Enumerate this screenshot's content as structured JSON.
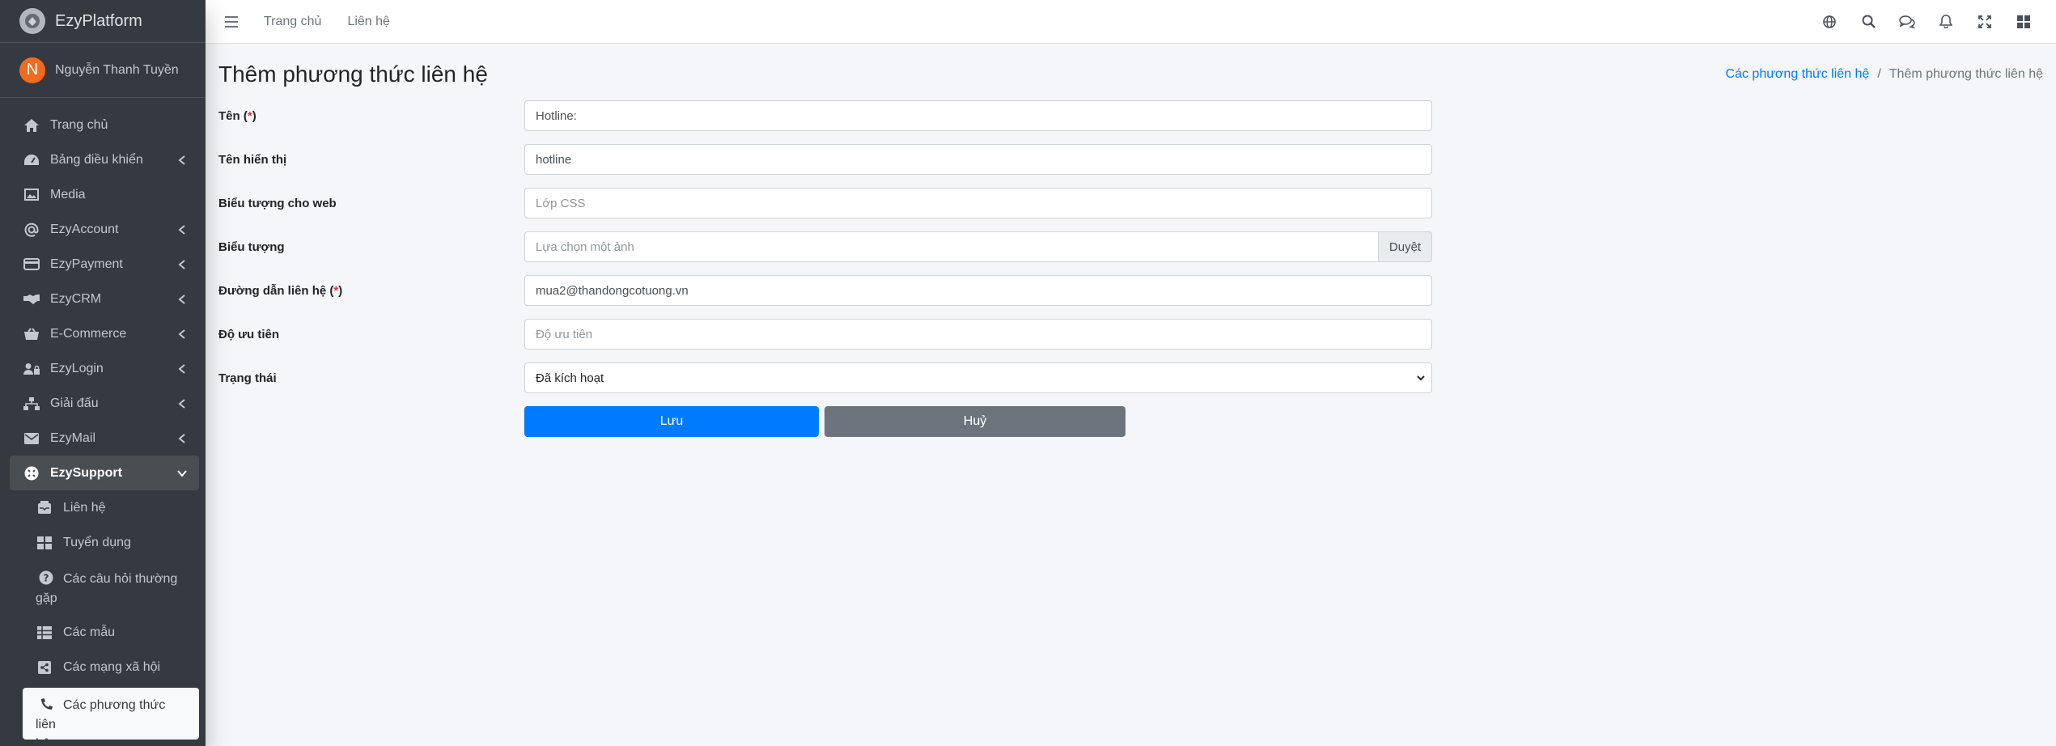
{
  "brand": {
    "name": "EzyPlatform"
  },
  "user": {
    "initial": "N",
    "name": "Nguyễn Thanh Tuyền"
  },
  "sidebar": {
    "items": [
      {
        "label": "Trang chủ",
        "icon": "home-icon"
      },
      {
        "label": "Bảng điều khiển",
        "icon": "dashboard-icon"
      },
      {
        "label": "Media",
        "icon": "image-icon"
      },
      {
        "label": "EzyAccount",
        "icon": "at-icon"
      },
      {
        "label": "EzyPayment",
        "icon": "credit-card-icon"
      },
      {
        "label": "EzyCRM",
        "icon": "handshake-icon"
      },
      {
        "label": "E-Commerce",
        "icon": "basket-icon"
      },
      {
        "label": "EzyLogin",
        "icon": "user-lock-icon"
      },
      {
        "label": "Giải đấu",
        "icon": "sitemap-icon"
      },
      {
        "label": "EzyMail",
        "icon": "envelope-icon"
      },
      {
        "label": "EzySupport",
        "icon": "support-icon"
      }
    ],
    "sub_items": [
      {
        "label": "Liên hệ",
        "icon": "inbox-icon"
      },
      {
        "label": "Tuyển dụng",
        "icon": "th-large-icon"
      },
      {
        "label_line1": "Các câu hỏi thường",
        "label_line2": "gặp",
        "icon": "question-circle-icon"
      },
      {
        "label": "Các mẫu",
        "icon": "table-icon"
      },
      {
        "label": "Các mạng xã hội",
        "icon": "share-square-icon"
      },
      {
        "label_line1": "Các phương thức liên",
        "label_line2": "hệ",
        "icon": "phone-icon"
      }
    ]
  },
  "topbar": {
    "links": [
      "Trang chủ",
      "Liên hệ"
    ],
    "icons": [
      "globe-icon",
      "search-icon",
      "comments-icon",
      "bell-icon",
      "expand-icon",
      "apps-icon"
    ]
  },
  "page": {
    "title": "Thêm phương thức liên hệ",
    "breadcrumb": {
      "parent": "Các phương thức liên hệ",
      "separator": "/",
      "current": "Thêm phương thức liên hệ"
    }
  },
  "form": {
    "name": {
      "label": "Tên",
      "req_open": " (",
      "req_star": "*",
      "req_close": ")",
      "value": "Hotline:"
    },
    "display_name": {
      "label": "Tên hiển thị",
      "value": "hotline"
    },
    "web_icon": {
      "label": "Biểu tượng cho web",
      "placeholder": "Lớp CSS"
    },
    "icon": {
      "label": "Biểu tượng",
      "placeholder": "Lựa chọn một ảnh",
      "browse": "Duyệt"
    },
    "link": {
      "label": "Đường dẫn liên hệ",
      "req_open": " (",
      "req_star": "*",
      "req_close": ")",
      "value": "mua2@thandongcotuong.vn"
    },
    "priority": {
      "label": "Độ ưu tiên",
      "placeholder": "Độ ưu tiên"
    },
    "status": {
      "label": "Trạng thái",
      "value": "Đã kích hoạt"
    },
    "save_label": "Lưu",
    "cancel_label": "Huỷ"
  },
  "colors": {
    "sidebar": "#343a40",
    "primary": "#007bff",
    "secondary": "#6c757d",
    "avatar": "#f26b1d"
  }
}
